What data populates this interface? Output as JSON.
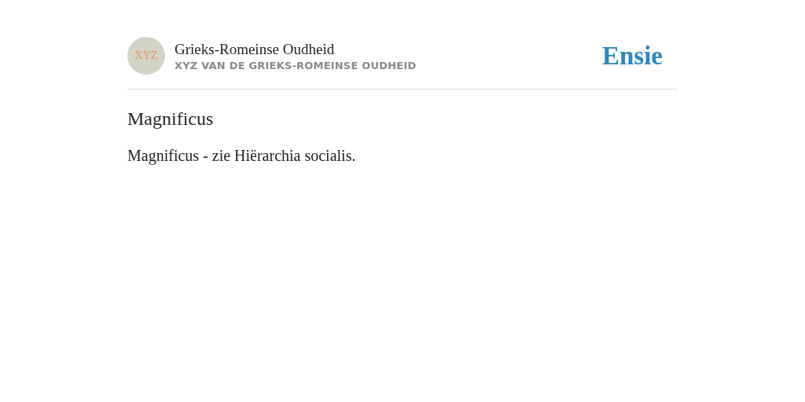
{
  "header": {
    "avatar_text": "XYZ",
    "title": "Grieks-Romeinse Oudheid",
    "subtitle": "XYZ VAN DE GRIEKS-ROMEINSE OUDHEID",
    "logo": "Ensie"
  },
  "article": {
    "heading": "Magnificus",
    "body": "Magnificus - zie Hiërarchia socialis."
  }
}
